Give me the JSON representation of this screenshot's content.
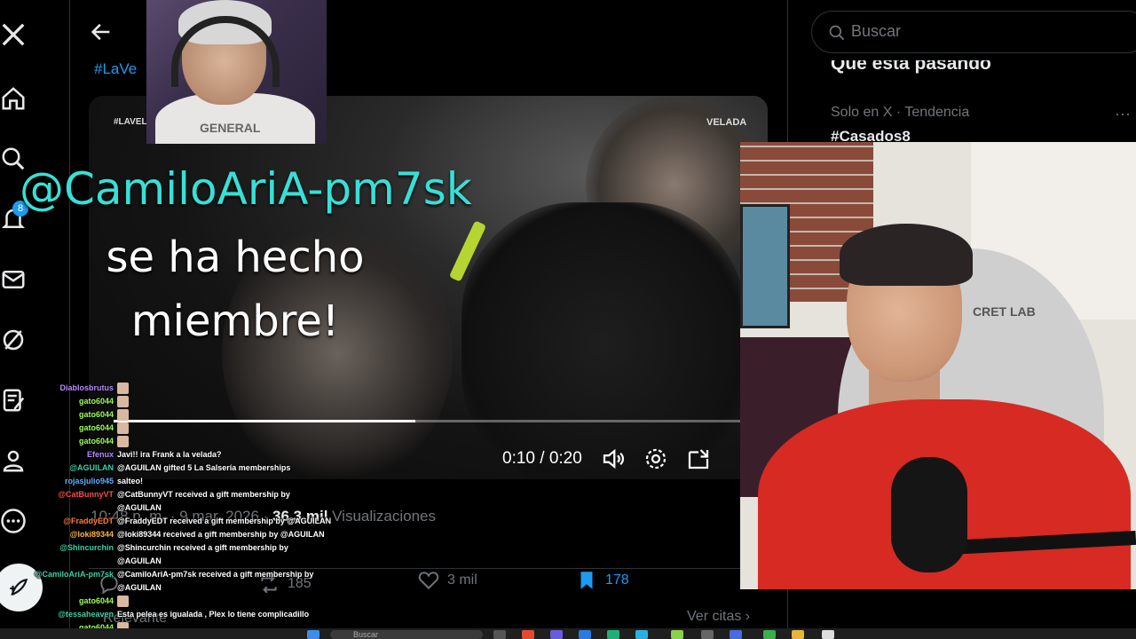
{
  "nav": {
    "notifications_badge": "8",
    "items": [
      "x-logo-icon",
      "home-icon",
      "search-icon",
      "bell-icon",
      "mail-icon",
      "grok-icon",
      "compose-list-icon",
      "profile-icon",
      "more-icon"
    ]
  },
  "tweet": {
    "hashtag": "#LaVe",
    "video_watermark_left": "#LAVELAD",
    "video_watermark_right": "VELADA",
    "time": "0:10 / 0:20",
    "progress": 0.48,
    "meta_time": "10:48 p. m. · 9 mar. 2026 · ",
    "views_count": "36,3 mil",
    "views_label": " Visualizaciones",
    "replies": "",
    "reposts": "185",
    "likes": "3 mil",
    "bookmarks": "178",
    "see_quotes": "Ver citas ›",
    "relevant": "Relevante"
  },
  "search": {
    "placeholder": "Buscar"
  },
  "sidebar": {
    "whats_happening": "Qué está pasando",
    "trend_context": "Solo en X · Tendencia",
    "trend_name": "#Casados8",
    "trend_more": "···"
  },
  "streamer_top": {
    "hoodie_text": "GENERAL"
  },
  "streamer_right": {
    "chair_logo": "CRET LAB"
  },
  "alert": {
    "username": "@CamiloAriA-pm7sk",
    "message": "se ha hecho miembre!"
  },
  "chat": [
    {
      "user": "Diablosbrutus",
      "color": "#b48cff",
      "text": "",
      "emote": true
    },
    {
      "user": "gato6044",
      "color": "#9cff5a",
      "text": "",
      "emote": true
    },
    {
      "user": "gato6044",
      "color": "#9cff5a",
      "text": "",
      "emote": true
    },
    {
      "user": "gato6044",
      "color": "#9cff5a",
      "text": "",
      "emote": true
    },
    {
      "user": "gato6044",
      "color": "#9cff5a",
      "text": "",
      "emote": true
    },
    {
      "user": "Efenux",
      "color": "#b48cff",
      "text": "Javi!! ira Frank a la velada?",
      "emote": false
    },
    {
      "user": "@AGUILAN",
      "color": "#3ad1a8",
      "text": "@AGUILAN gifted 5 La Salsería memberships",
      "emote": false
    },
    {
      "user": "rojasjulio945",
      "color": "#5ab0ff",
      "text": "salteo!",
      "emote": false
    },
    {
      "user": "@CatBunnyVT",
      "color": "#ff4a4a",
      "text": "@CatBunnyVT received a gift membership by",
      "emote": false
    },
    {
      "user": "",
      "color": "#ffffff",
      "text": "@AGUILAN",
      "emote": false
    },
    {
      "user": "@FraddyEDT",
      "color": "#ff7a3a",
      "text": "@FraddyEDT received a gift membership by @AGUILAN",
      "emote": false
    },
    {
      "user": "@loki89344",
      "color": "#ffb43a",
      "text": "@loki89344 received a gift membership by @AGUILAN",
      "emote": false
    },
    {
      "user": "@Shincurchin",
      "color": "#3ad1a8",
      "text": "@Shincurchin received a gift membership by",
      "emote": false
    },
    {
      "user": "",
      "color": "#ffffff",
      "text": "@AGUILAN",
      "emote": false
    },
    {
      "user": "@CamiloAriA-pm7sk",
      "color": "#3ad1a8",
      "text": "@CamiloAriA-pm7sk received a gift membership by",
      "emote": false
    },
    {
      "user": "",
      "color": "#ffffff",
      "text": "@AGUILAN",
      "emote": false
    },
    {
      "user": "gato6044",
      "color": "#9cff5a",
      "text": "",
      "emote": true
    },
    {
      "user": "@tessaheaven",
      "color": "#3ad1a8",
      "text": "Esta pelea es igualada , Plex lo tiene complicadillo",
      "emote": false
    },
    {
      "user": "gato6044",
      "color": "#9cff5a",
      "text": "",
      "emote": true
    }
  ],
  "taskbar": {
    "search_placeholder": "Buscar"
  },
  "colors": {
    "accent": "#1d9bf0",
    "alert_user": "#37e0d6",
    "jersey": "#d62a22"
  }
}
